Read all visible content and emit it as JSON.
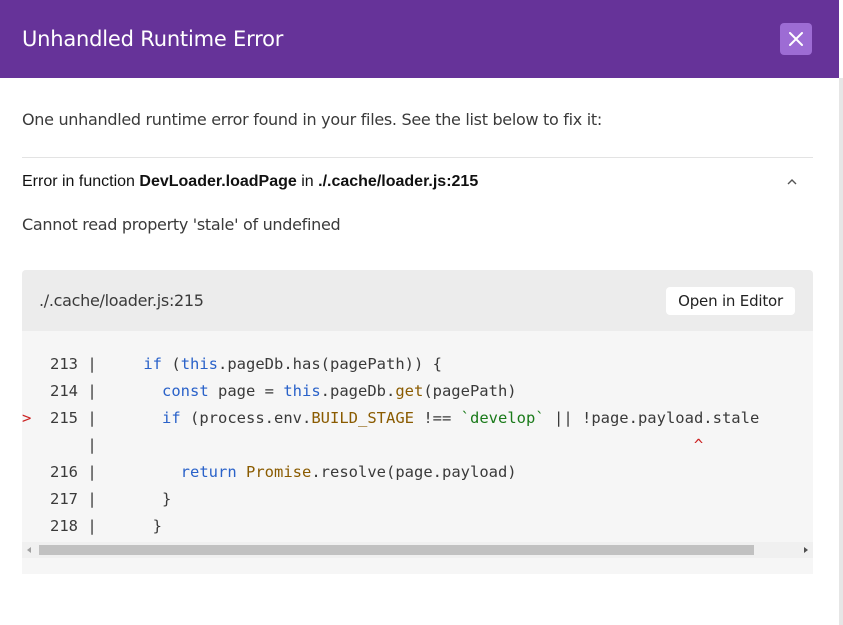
{
  "header": {
    "title": "Unhandled Runtime Error",
    "close_icon": "close-icon"
  },
  "summary": "One unhandled runtime error found in your files. See the list below to fix it:",
  "error": {
    "prefix": "Error in function ",
    "function_name": "DevLoader.loadPage",
    "middle": " in ",
    "location": "./.cache/loader.js:215",
    "toggle_icon": "chevron-up-icon",
    "message": "Cannot read property 'stale' of undefined"
  },
  "code_frame": {
    "file": "./.cache/loader.js:215",
    "open_editor_label": "Open in Editor",
    "highlight_color": "#cc2222",
    "lines": [
      {
        "marker": "  ",
        "num": " 213 |",
        "indent": "     ",
        "code": "if (this.pageDb.has(pagePath)) {"
      },
      {
        "marker": "  ",
        "num": " 214 |",
        "indent": "       ",
        "code": "const page = this.pageDb.get(pagePath)"
      },
      {
        "marker": "> ",
        "num": " 215 |",
        "indent": "       ",
        "code": "if (process.env.BUILD_STAGE !== `develop` || !page.payload.stale"
      },
      {
        "marker": "  ",
        "num": "     |",
        "indent": "",
        "code": "                                                                ^"
      },
      {
        "marker": "  ",
        "num": " 216 |",
        "indent": "         ",
        "code": "return Promise.resolve(page.payload)"
      },
      {
        "marker": "  ",
        "num": " 217 |",
        "indent": "       ",
        "code": "}"
      },
      {
        "marker": "  ",
        "num": " 218 |",
        "indent": "      ",
        "code": "}"
      }
    ]
  },
  "colors": {
    "header_bg": "#663399",
    "close_bg": "#9d6cd4",
    "keyword": "#2a62c9",
    "function": "#8a5b00",
    "string": "#1a7a1a"
  }
}
